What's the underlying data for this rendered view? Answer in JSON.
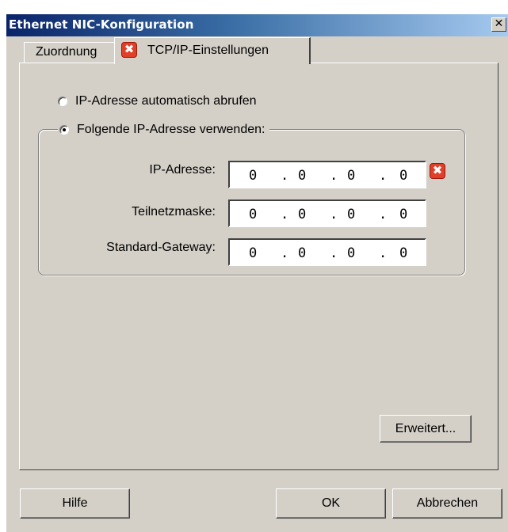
{
  "window": {
    "title": "Ethernet NIC-Konfiguration",
    "close_glyph": "✕"
  },
  "tabs": [
    {
      "label": "Zuordnung"
    },
    {
      "label": "TCP/IP-Einstellungen",
      "icon": "error-icon"
    }
  ],
  "radio_auto": {
    "label": "IP-Adresse automatisch abrufen",
    "checked": false
  },
  "radio_manual": {
    "label": "Folgende IP-Adresse verwenden:",
    "checked": true
  },
  "fields": {
    "ip": {
      "label": "IP-Adresse:",
      "octets": [
        "0",
        "0",
        "0",
        "0"
      ],
      "error": true
    },
    "mask": {
      "label": "Teilnetzmaske:",
      "octets": [
        "0",
        "0",
        "0",
        "0"
      ]
    },
    "gateway": {
      "label": "Standard-Gateway:",
      "octets": [
        "0",
        "0",
        "0",
        "0"
      ]
    }
  },
  "error_glyph": "✖",
  "dot": ".",
  "buttons": {
    "advanced": "Erweitert...",
    "help": "Hilfe",
    "ok": "OK",
    "cancel": "Abbrechen"
  },
  "colors": {
    "title_start": "#0a246a",
    "title_end": "#a6caf0",
    "face": "#d4d0c8",
    "error": "#e0402a"
  }
}
